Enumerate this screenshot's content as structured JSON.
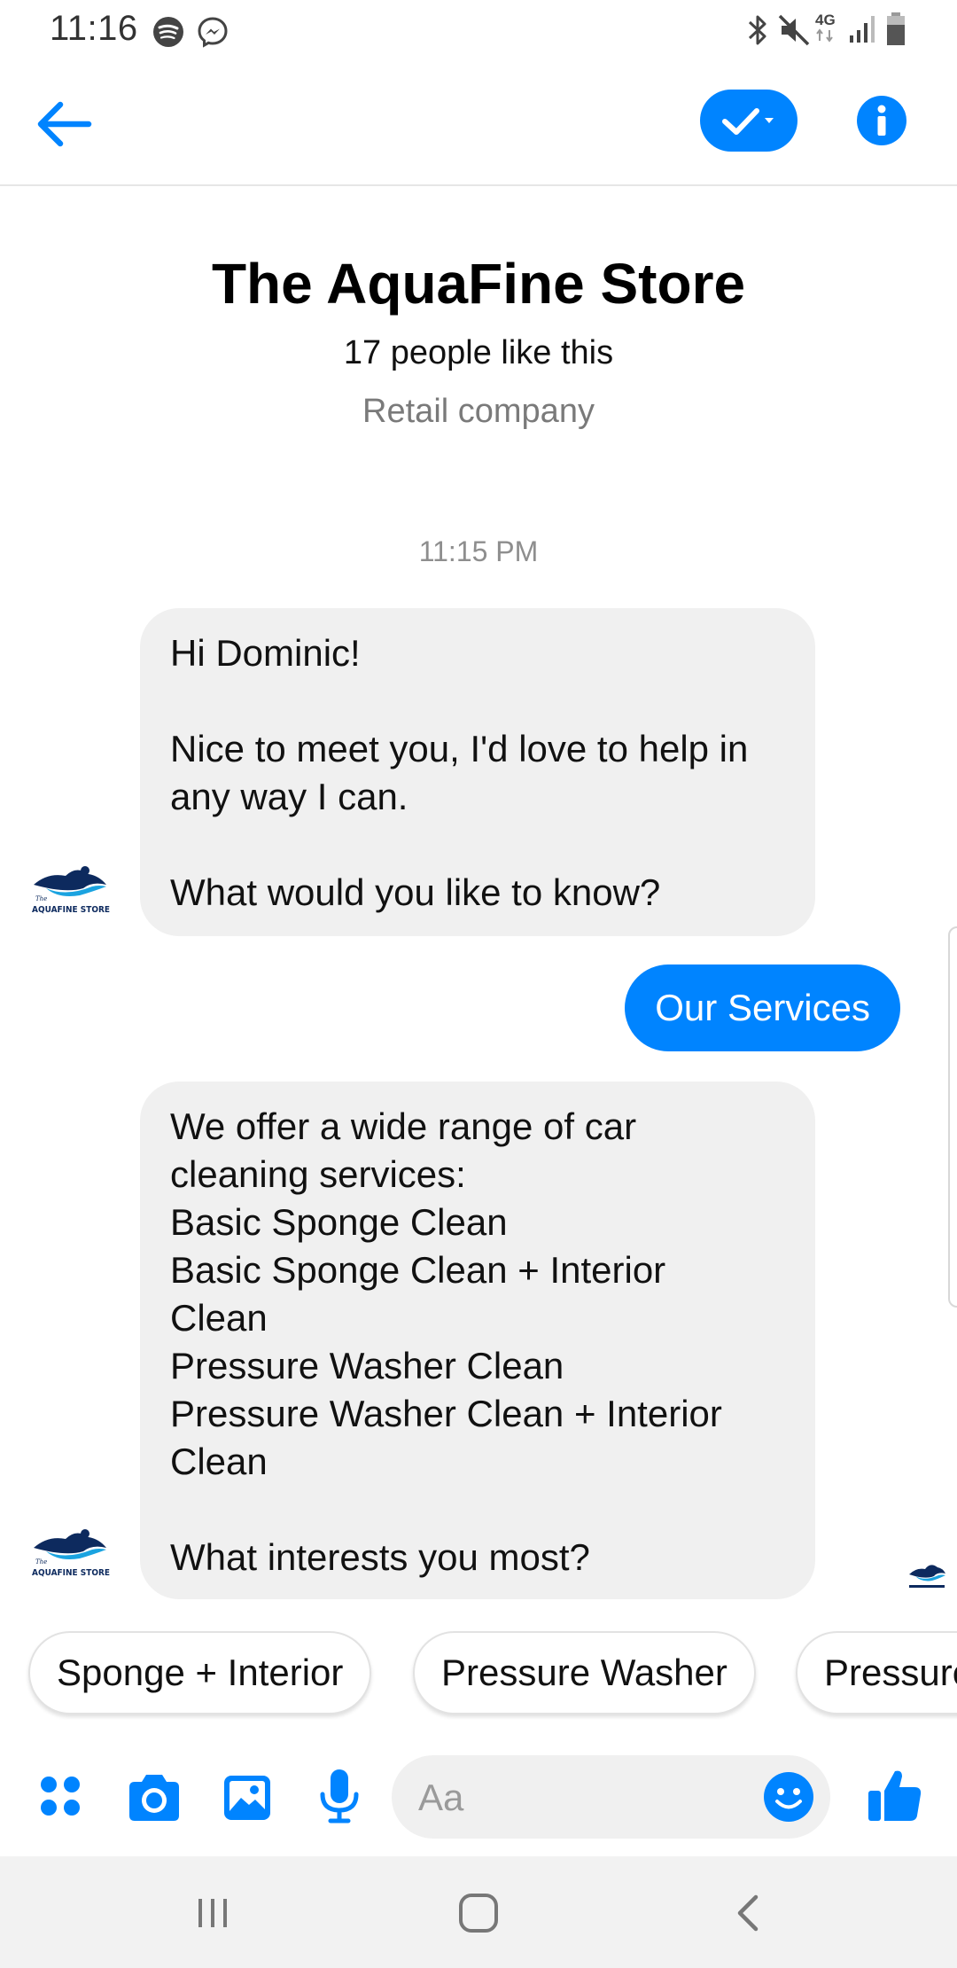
{
  "status_bar": {
    "time": "11:16",
    "network_label": "4G"
  },
  "header": {
    "back_icon": "arrow-left-icon",
    "mark_done_icon": "checkmark-dropdown-icon",
    "info_icon": "info-icon",
    "accent_color": "#0084ff"
  },
  "profile": {
    "name": "The AquaFine Store",
    "likes": "17 people like this",
    "category": "Retail company"
  },
  "conversation": {
    "timestamp": "11:15 PM",
    "messages": [
      {
        "direction": "incoming",
        "lines": [
          "Hi Dominic!",
          "",
          "Nice to meet you, I'd love to help in",
          "any way I can.",
          "",
          "What would you like to know?"
        ]
      },
      {
        "direction": "outgoing",
        "text": "Our Services"
      },
      {
        "direction": "incoming",
        "lines": [
          "We offer a wide range of car",
          "cleaning services:",
          "Basic Sponge Clean",
          "Basic Sponge Clean + Interior",
          "Clean",
          "Pressure Washer Clean",
          "Pressure Washer Clean + Interior",
          "Clean",
          "",
          "What interests you most?"
        ]
      }
    ],
    "avatar_logo_text": "AQUAFINE STORE",
    "avatar_logo_small": "The"
  },
  "quick_replies": [
    "Sponge + Interior",
    "Pressure Washer",
    "Pressure Washer + Interior"
  ],
  "composer": {
    "placeholder": "Aa",
    "icons": [
      "apps-icon",
      "camera-icon",
      "gallery-icon",
      "microphone-icon",
      "emoji-icon",
      "thumbs-up-icon"
    ]
  },
  "nav_bar": {
    "icons": [
      "recents-icon",
      "home-icon",
      "back-icon"
    ]
  }
}
